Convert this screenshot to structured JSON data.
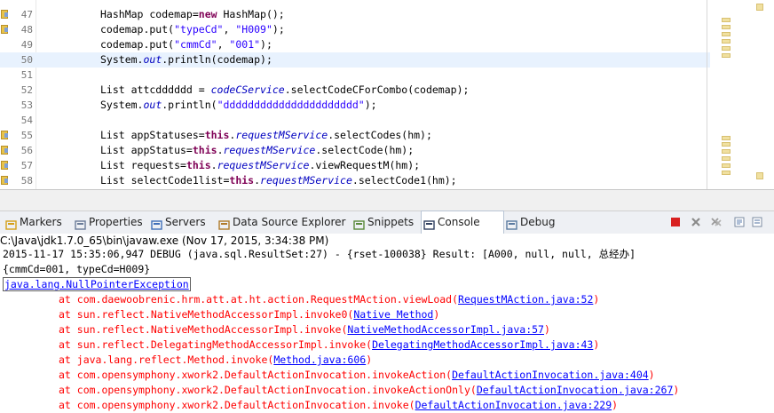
{
  "editor": {
    "lines": [
      {
        "num": "47",
        "marker": true,
        "current": false,
        "parts": [
          [
            "cls",
            "HashMap codemap="
          ],
          [
            "kw",
            "new"
          ],
          [
            "cls",
            " HashMap();"
          ]
        ]
      },
      {
        "num": "48",
        "marker": true,
        "current": false,
        "parts": [
          [
            "cls",
            "codemap.put("
          ],
          [
            "str",
            "\"typeCd\""
          ],
          [
            "cls",
            ", "
          ],
          [
            "str",
            "\"H009\""
          ],
          [
            "cls",
            ");"
          ]
        ]
      },
      {
        "num": "49",
        "marker": false,
        "current": false,
        "parts": [
          [
            "cls",
            "codemap.put("
          ],
          [
            "str",
            "\"cmmCd\""
          ],
          [
            "cls",
            ", "
          ],
          [
            "str",
            "\"001\""
          ],
          [
            "cls",
            ");"
          ]
        ]
      },
      {
        "num": "50",
        "marker": false,
        "current": true,
        "parts": [
          [
            "cls",
            "System."
          ],
          [
            "fld",
            "out"
          ],
          [
            "cls",
            ".println(codemap);"
          ]
        ]
      },
      {
        "num": "51",
        "marker": false,
        "current": false,
        "parts": []
      },
      {
        "num": "52",
        "marker": false,
        "current": false,
        "parts": [
          [
            "cls",
            "List attcdddddd = "
          ],
          [
            "fld",
            "codeCService"
          ],
          [
            "cls",
            ".selectCodeCForCombo(codemap);"
          ]
        ]
      },
      {
        "num": "53",
        "marker": false,
        "current": false,
        "parts": [
          [
            "cls",
            "System."
          ],
          [
            "fld",
            "out"
          ],
          [
            "cls",
            ".println("
          ],
          [
            "str",
            "\"dddddddddddddddddddddd\""
          ],
          [
            "cls",
            ");"
          ]
        ]
      },
      {
        "num": "54",
        "marker": false,
        "current": false,
        "parts": []
      },
      {
        "num": "55",
        "marker": true,
        "current": false,
        "parts": [
          [
            "cls",
            "List appStatuses="
          ],
          [
            "kw",
            "this"
          ],
          [
            "cls",
            "."
          ],
          [
            "fld",
            "requestMService"
          ],
          [
            "cls",
            ".selectCodes(hm);"
          ]
        ]
      },
      {
        "num": "56",
        "marker": true,
        "current": false,
        "parts": [
          [
            "cls",
            "List appStatus="
          ],
          [
            "kw",
            "this"
          ],
          [
            "cls",
            "."
          ],
          [
            "fld",
            "requestMService"
          ],
          [
            "cls",
            ".selectCode(hm);"
          ]
        ]
      },
      {
        "num": "57",
        "marker": true,
        "current": false,
        "parts": [
          [
            "cls",
            "List requests="
          ],
          [
            "kw",
            "this"
          ],
          [
            "cls",
            "."
          ],
          [
            "fld",
            "requestMService"
          ],
          [
            "cls",
            ".viewRequestM(hm);"
          ]
        ]
      },
      {
        "num": "58",
        "marker": true,
        "current": false,
        "parts": [
          [
            "cls",
            "List selectCode1list="
          ],
          [
            "kw",
            "this"
          ],
          [
            "cls",
            "."
          ],
          [
            "fld",
            "requestMService"
          ],
          [
            "cls",
            ".selectCode1(hm);"
          ]
        ]
      }
    ]
  },
  "tabs": [
    {
      "label": "Markers",
      "icon": "markers-icon",
      "active": false
    },
    {
      "label": "Properties",
      "icon": "properties-icon",
      "active": false
    },
    {
      "label": "Servers",
      "icon": "servers-icon",
      "active": false
    },
    {
      "label": "Data Source Explorer",
      "icon": "data-source-explorer-icon",
      "active": false
    },
    {
      "label": "Snippets",
      "icon": "snippets-icon",
      "active": false
    },
    {
      "label": "Console",
      "icon": "console-icon",
      "active": true
    },
    {
      "label": "Debug",
      "icon": "debug-icon",
      "active": false
    }
  ],
  "toolbar_icons": [
    "terminate-icon",
    "remove-launch-icon",
    "remove-all-terminated-icon",
    "scroll-lock-icon",
    "pin-console-icon",
    "display-selected-console-icon"
  ],
  "console": {
    "process": "C:\\Java\\jdk1.7.0_65\\bin\\javaw.exe (Nov 17, 2015, 3:34:38 PM)",
    "lines": [
      {
        "kind": "plain",
        "text": "2015-11-17 15:35:06,947 DEBUG (java.sql.ResultSet:27) - {rset-100038} Result: [A000, null, null, 总经办]"
      },
      {
        "kind": "plain",
        "text": "{cmmCd=001, typeCd=H009}"
      },
      {
        "kind": "exception",
        "text": "java.lang.NullPointerException"
      },
      {
        "kind": "trace",
        "text": "\tat com.daewoobrenic.hrm.att.at.ht.action.RequestMAction.viewLoad(",
        "link": "RequestMAction.java:52"
      },
      {
        "kind": "trace",
        "text": "\tat sun.reflect.NativeMethodAccessorImpl.invoke0(",
        "link": "Native Method"
      },
      {
        "kind": "trace",
        "text": "\tat sun.reflect.NativeMethodAccessorImpl.invoke(",
        "link": "NativeMethodAccessorImpl.java:57"
      },
      {
        "kind": "trace",
        "text": "\tat sun.reflect.DelegatingMethodAccessorImpl.invoke(",
        "link": "DelegatingMethodAccessorImpl.java:43"
      },
      {
        "kind": "trace",
        "text": "\tat java.lang.reflect.Method.invoke(",
        "link": "Method.java:606"
      },
      {
        "kind": "trace",
        "text": "\tat com.opensymphony.xwork2.DefaultActionInvocation.invokeAction(",
        "link": "DefaultActionInvocation.java:404"
      },
      {
        "kind": "trace",
        "text": "\tat com.opensymphony.xwork2.DefaultActionInvocation.invokeActionOnly(",
        "link": "DefaultActionInvocation.java:267"
      },
      {
        "kind": "trace",
        "text": "\tat com.opensymphony.xwork2.DefaultActionInvocation.invoke(",
        "link": "DefaultActionInvocation.java:229"
      }
    ]
  },
  "colors": {
    "keyword": "#7f0055",
    "string": "#2a00ff",
    "field": "#0000c0",
    "error": "#ff0000",
    "link": "#0000ff",
    "current_line": "#e8f2fe"
  }
}
